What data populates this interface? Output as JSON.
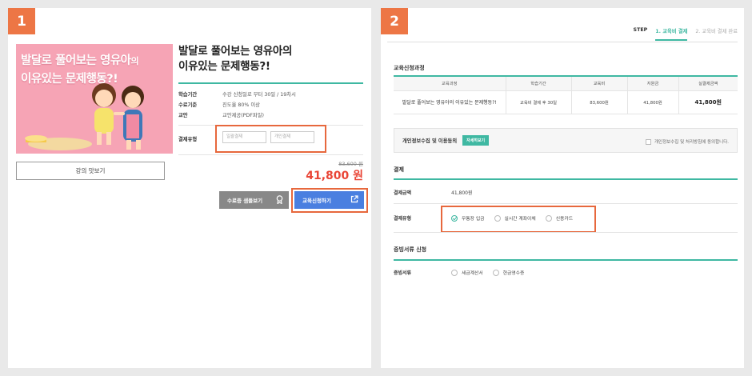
{
  "panel1": {
    "badge": "1",
    "thumb_title_line1": "발달로 풀어보는 영유아",
    "thumb_title_suffix": "의",
    "thumb_title_line2": "이유있는 문제행동?!",
    "preview_label": "강의 맛보기",
    "course_title_line1": "발달로 풀어보는 영유아의",
    "course_title_line2": "이유있는 문제행동?!",
    "info": [
      {
        "key": "학습기간",
        "value": "수강 신청일로 부터 30일 / 19차시"
      },
      {
        "key": "수료기준",
        "value": "진도율 80% 이상"
      },
      {
        "key": "교안",
        "value": "교안제공(PDF파일)"
      }
    ],
    "pay_label": "결제유형",
    "pay_option1": "일괄결제",
    "pay_option2": "개인결제",
    "old_price": "83,600 원",
    "new_price": "41,800 원",
    "sample_label": "수료증 샘플보기",
    "apply_label": "교육신청하기"
  },
  "panel2": {
    "badge": "2",
    "steps": {
      "lead": "STEP",
      "step1": "1.  교육비 결제",
      "step2": "2.  교육비 결제 완료"
    },
    "course_section_title": "교육신청과정",
    "table": {
      "headers": [
        "교육과정",
        "학습기간",
        "교육비",
        "지원금",
        "실결제금액"
      ],
      "row": [
        "발달로 풀어보는 영유아의 이유있는 문제행동?!",
        "교육비 결제 후 30일",
        "83,600원",
        "41,800원",
        "41,800원"
      ]
    },
    "consent_label": "개인정보수집 및 이용동의",
    "consent_detail": "자세히보기",
    "consent_check_label": "개인정보수집 및 처리방침에 동의합니다.",
    "payment_section_title": "결제",
    "amount_key": "결제금액",
    "amount_value": "41,800원",
    "pay_type_key": "결제유형",
    "pay_types": [
      "무통장 입금",
      "실시간 계좌이체",
      "신용카드"
    ],
    "receipt_section_title": "증빙서류 신청",
    "receipt_key": "증빙서류",
    "receipt_types": [
      "세금계산서",
      "현금영수증"
    ]
  },
  "colors": {
    "badge": "#ed7645",
    "highlight": "#e7683d",
    "teal": "#3fb8a2",
    "price": "#e94435",
    "apply_btn": "#4a7fe0",
    "sample_btn": "#888888"
  }
}
